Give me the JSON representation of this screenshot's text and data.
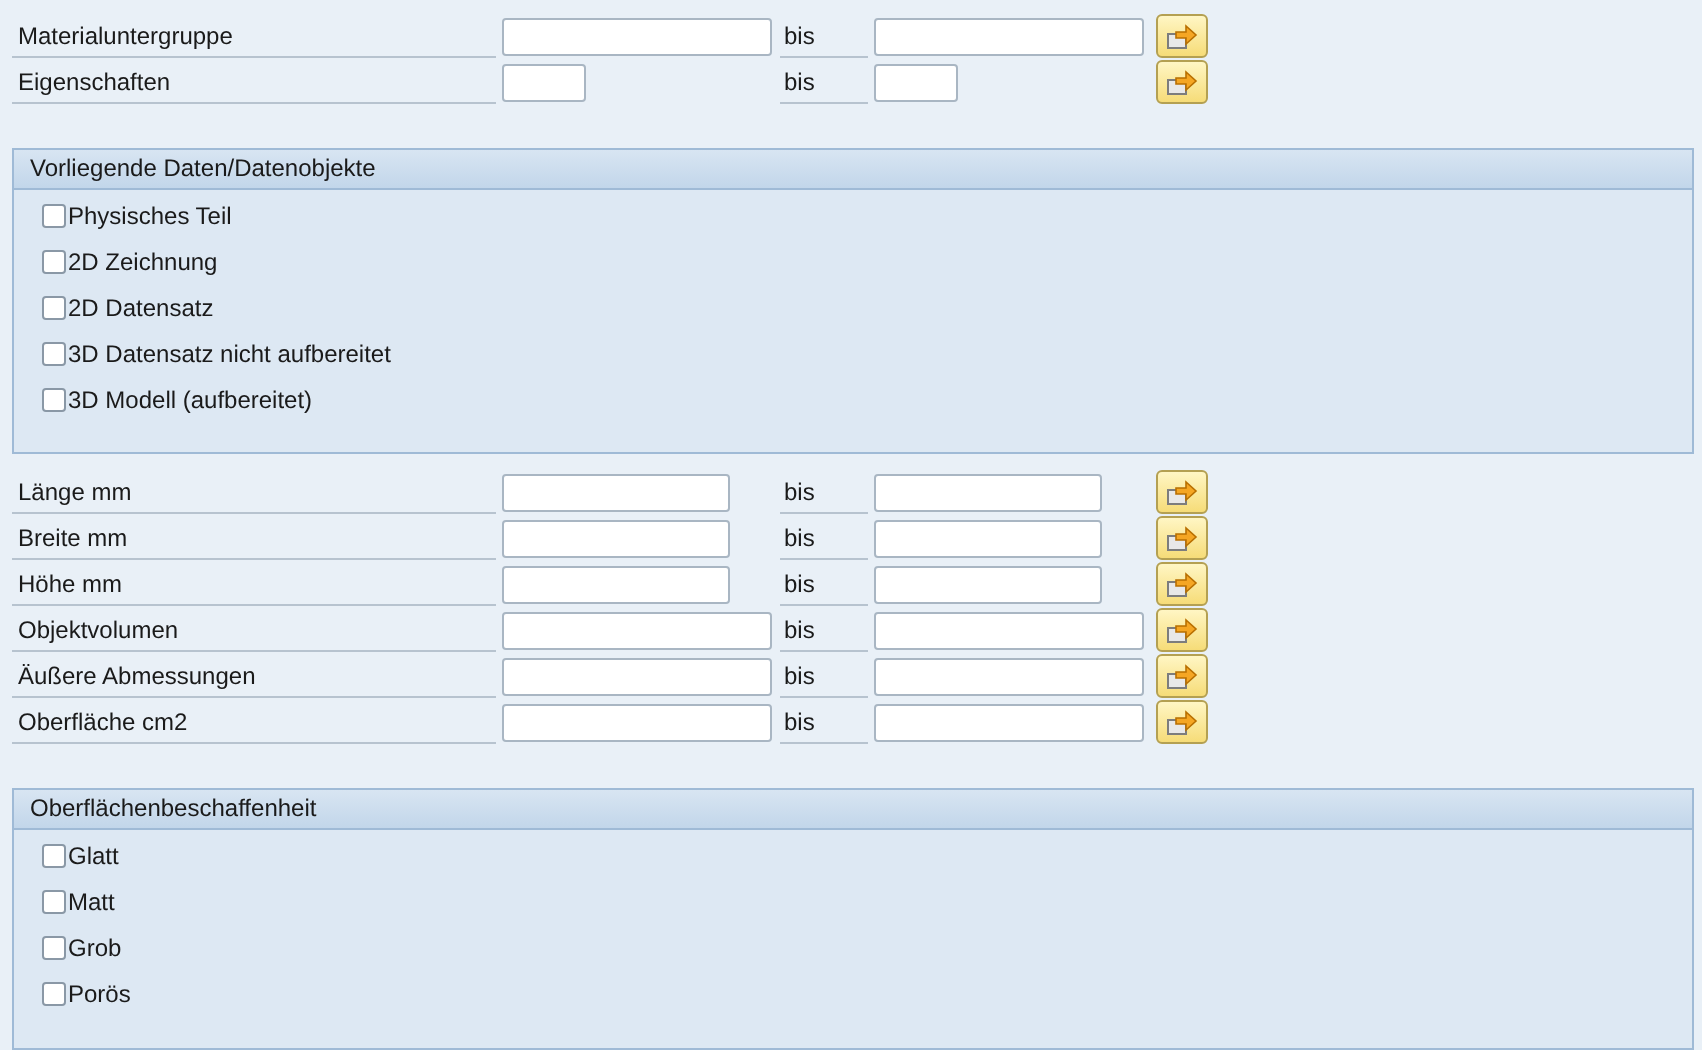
{
  "range_rows_top": [
    {
      "label": "Materialuntergruppe",
      "kind": "long",
      "separator": "bis"
    },
    {
      "label": "Eigenschaften",
      "kind": "short",
      "separator": "bis"
    }
  ],
  "data_group": {
    "title": "Vorliegende Daten/Datenobjekte",
    "options": [
      {
        "label": "Physisches Teil",
        "checked": false
      },
      {
        "label": "2D Zeichnung",
        "checked": false
      },
      {
        "label": "2D Datensatz",
        "checked": false
      },
      {
        "label": "3D Datensatz nicht aufbereitet",
        "checked": false
      },
      {
        "label": "3D Modell (aufbereitet)",
        "checked": false
      }
    ]
  },
  "range_rows_dimensions": [
    {
      "label": "Länge mm",
      "kind": "medium",
      "separator": "bis"
    },
    {
      "label": "Breite mm",
      "kind": "medium",
      "separator": "bis"
    },
    {
      "label": "Höhe mm",
      "kind": "medium",
      "separator": "bis"
    },
    {
      "label": "Objektvolumen",
      "kind": "long",
      "separator": "bis"
    },
    {
      "label": "Äußere Abmessungen",
      "kind": "long",
      "separator": "bis"
    },
    {
      "label": "Oberfläche cm2",
      "kind": "long",
      "separator": "bis"
    }
  ],
  "surface_group": {
    "title": "Oberflächenbeschaffenheit",
    "options": [
      {
        "label": "Glatt",
        "checked": false
      },
      {
        "label": "Matt",
        "checked": false
      },
      {
        "label": "Grob",
        "checked": false
      },
      {
        "label": "Porös",
        "checked": false
      }
    ]
  }
}
